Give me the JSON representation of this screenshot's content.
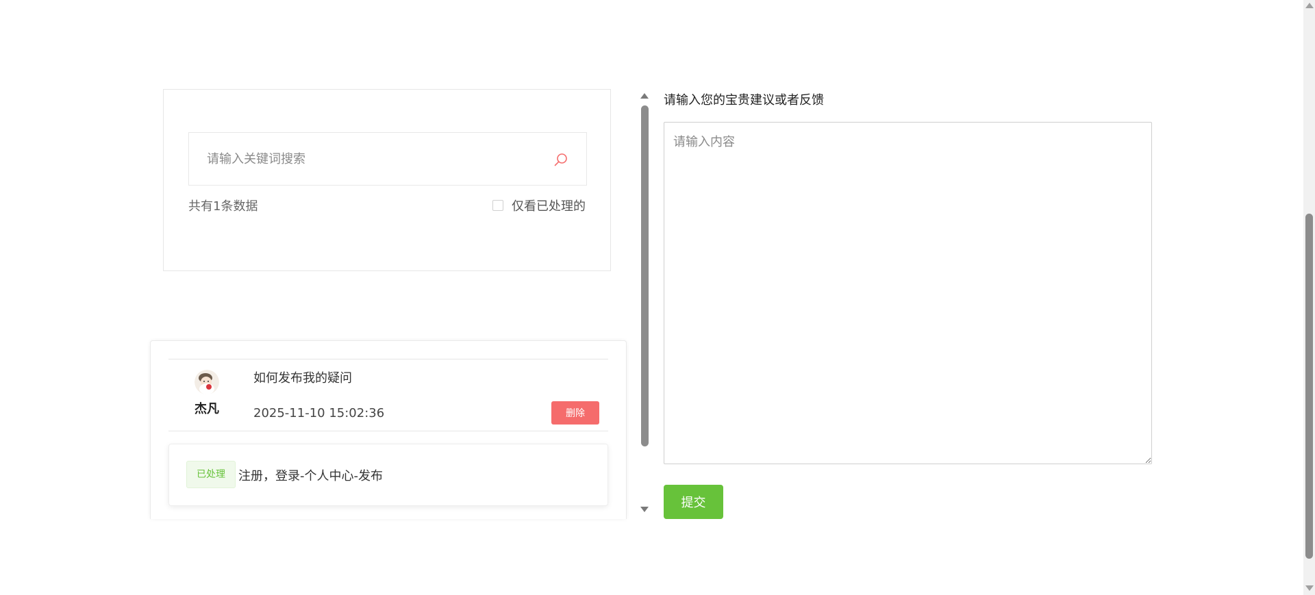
{
  "search": {
    "placeholder": "请输入关键词搜索",
    "icon": "search-icon",
    "icon_color": "#f56c6c"
  },
  "summary": {
    "count_text": "共有1条数据",
    "filter_label": "仅看已处理的",
    "filter_checked": false
  },
  "list": {
    "items": [
      {
        "username": "杰凡",
        "question": "如何发布我的疑问",
        "timestamp": "2025-11-10 15:02:36",
        "delete_label": "删除",
        "reply": {
          "status": "已处理",
          "text": "注册，登录-个人中心-发布"
        }
      }
    ]
  },
  "feedback": {
    "label": "请输入您的宝贵建议或者反馈",
    "placeholder": "请输入内容",
    "submit_label": "提交"
  },
  "colors": {
    "danger": "#f56c6c",
    "success": "#67c23a",
    "success_bg": "#f0f9eb"
  }
}
